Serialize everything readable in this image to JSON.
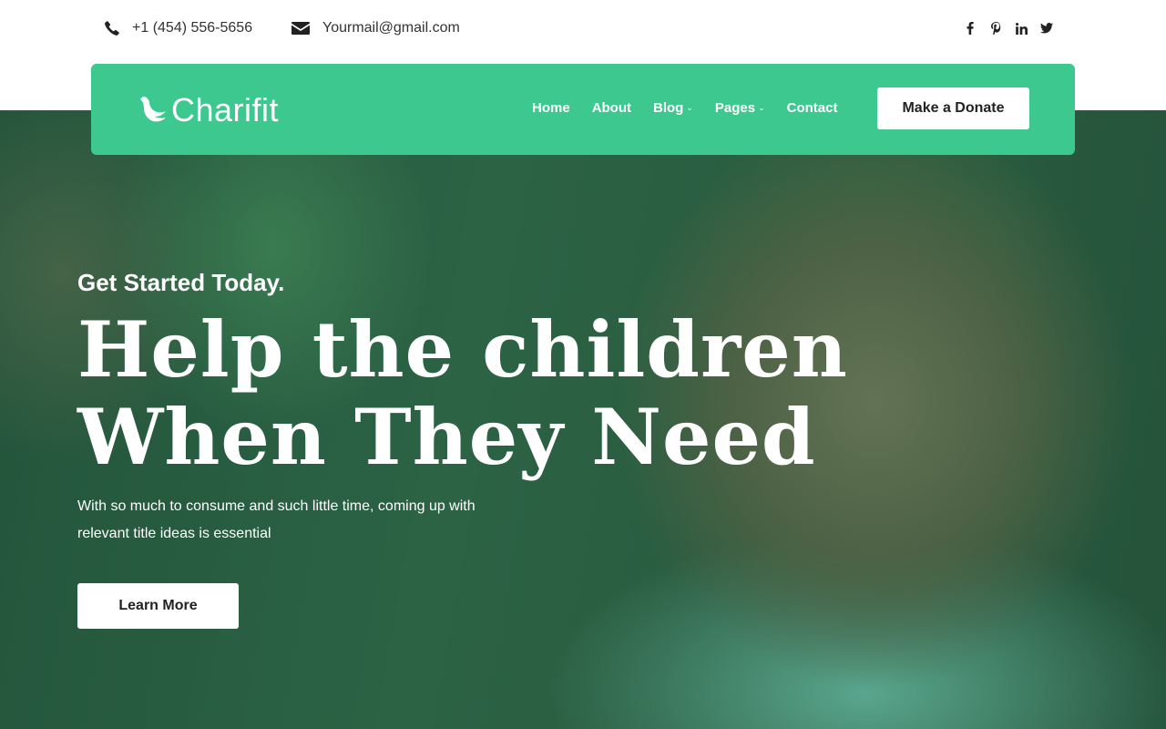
{
  "topbar": {
    "phone": "+1 (454) 556-5656",
    "email": "Yourmail@gmail.com",
    "socials": [
      "facebook-icon",
      "pinterest-icon",
      "linkedin-icon",
      "twitter-icon"
    ]
  },
  "navbar": {
    "brand": "Charifit",
    "links": [
      {
        "label": "Home",
        "dropdown": false
      },
      {
        "label": "About",
        "dropdown": false
      },
      {
        "label": "Blog",
        "dropdown": true
      },
      {
        "label": "Pages",
        "dropdown": true
      },
      {
        "label": "Contact",
        "dropdown": false
      }
    ],
    "cta": "Make a Donate"
  },
  "hero": {
    "eyebrow": "Get Started Today.",
    "headline_line1": "Help the children",
    "headline_line2": "When They Need",
    "subtext": "With so much to consume and such little time, coming up with relevant title ideas is essential",
    "button": "Learn More"
  },
  "colors": {
    "brand_green": "#3cc88f",
    "text_dark": "#222222",
    "white": "#ffffff"
  }
}
